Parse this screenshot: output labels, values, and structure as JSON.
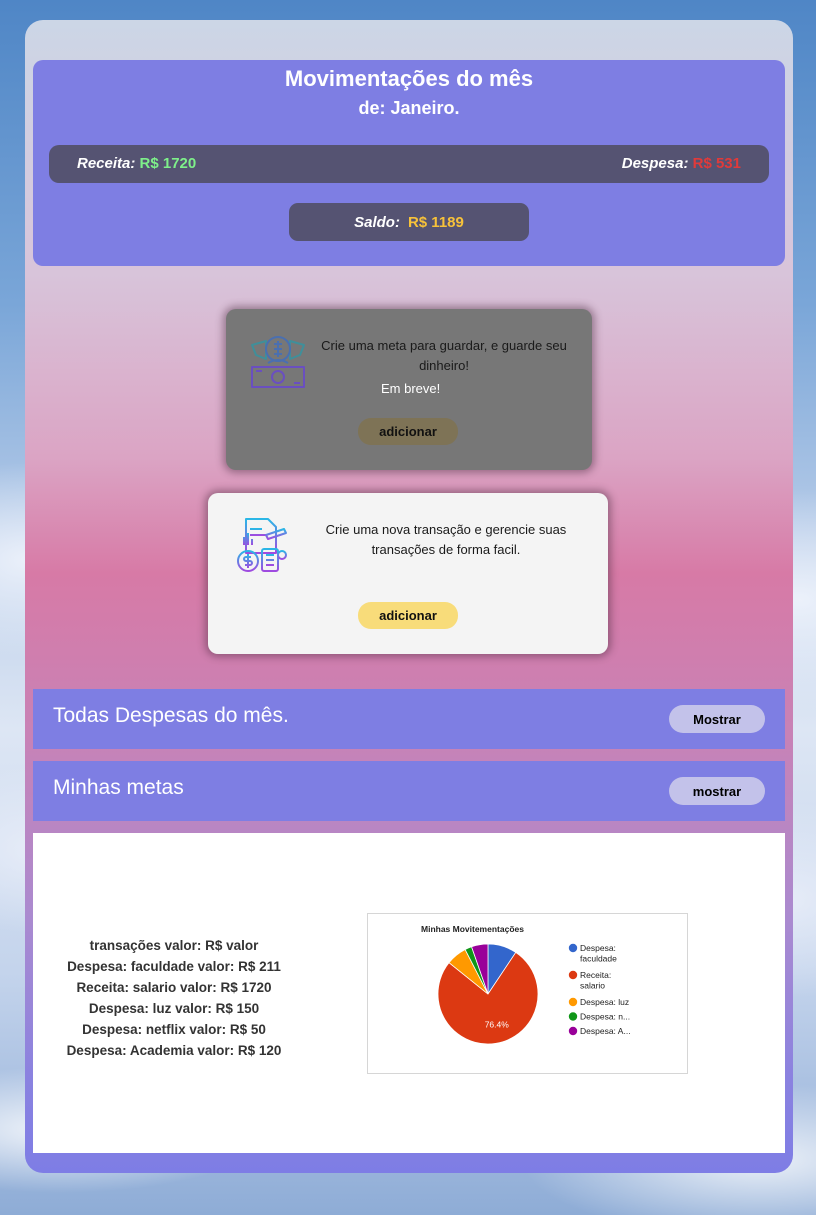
{
  "header": {
    "title": "Movimentações do mês",
    "subtitle": "de: Janeiro.",
    "receita_label": "Receita:",
    "receita_value": "R$ 1720",
    "despesa_label": "Despesa:",
    "despesa_value": "R$ 531",
    "saldo_label": "Saldo:",
    "saldo_value": "R$ 1189"
  },
  "goal_tile": {
    "text": "Crie uma meta para guardar, e guarde seu dinheiro!",
    "badge": "Em breve!",
    "button": "adicionar",
    "icon": "money-goal-icon"
  },
  "transaction_tile": {
    "text": "Crie uma nova transação e gerencie suas transações de forma facil.",
    "button": "adicionar",
    "icon": "finance-document-icon"
  },
  "sections": {
    "expenses": {
      "title": "Todas Despesas do mês.",
      "button": "Mostrar"
    },
    "goals": {
      "title": "Minhas metas",
      "button": "mostrar"
    }
  },
  "transactions": {
    "header": "transações valor: R$ valor",
    "items": [
      "Despesa: faculdade valor: R$ 211",
      "Receita: salario valor: R$ 1720",
      "Despesa: luz valor: R$ 150",
      "Despesa: netflix valor: R$ 50",
      "Despesa: Academia valor: R$ 120"
    ]
  },
  "colors": {
    "panel": "#7e7ee3",
    "bar": "#555372",
    "receita": "#7ef08a",
    "despesa": "#e03a3a",
    "saldo": "#f7c23a"
  },
  "chart_data": {
    "type": "pie",
    "title": "Minhas Movitementações",
    "categories": [
      "Despesa: faculdade",
      "Receita: salario",
      "Despesa: luz",
      "Despesa: netflix",
      "Despesa: Academia"
    ],
    "legend_labels": [
      "Despesa: faculdade",
      "Receita: salario",
      "Despesa: luz",
      "Despesa: n...",
      "Despesa: A..."
    ],
    "values": [
      211,
      1720,
      150,
      50,
      120
    ],
    "colors": [
      "#3366cc",
      "#dc3912",
      "#ff9900",
      "#109618",
      "#990099"
    ],
    "slice_labels": [
      "",
      "76.4%",
      "",
      "",
      ""
    ],
    "legend_position": "right"
  }
}
